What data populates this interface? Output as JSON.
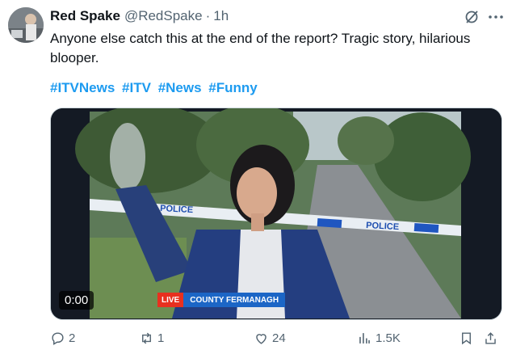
{
  "author": {
    "name": "Red Spake",
    "handle": "@RedSpake",
    "separator": "·",
    "time": "1h"
  },
  "tweet": {
    "text": "Anyone else catch this at the end of the report? Tragic story, hilarious blooper.",
    "hashtags": [
      "#ITVNews",
      "#ITV",
      "#News",
      "#Funny"
    ]
  },
  "media": {
    "timestamp": "0:00",
    "live_label": "LIVE",
    "location_label": "COUNTY FERMANAGH",
    "tape_text_left": "POLICE",
    "tape_text_right": "POLICE"
  },
  "actions": {
    "replies": "2",
    "reposts": "1",
    "likes": "24",
    "views": "1.5K"
  },
  "icons": [
    "grok-icon",
    "more-icon",
    "reply-icon",
    "repost-icon",
    "like-icon",
    "views-icon",
    "bookmark-icon",
    "share-icon"
  ],
  "colors": {
    "hashtag": "#1d9bf0",
    "secondary_text": "#536471",
    "live_red": "#e8301f",
    "location_blue": "#1c66c6"
  }
}
